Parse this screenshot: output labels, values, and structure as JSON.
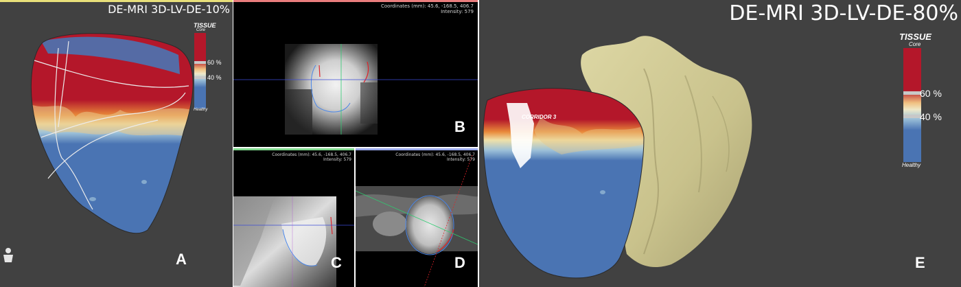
{
  "panel_a": {
    "title": "DE-MRI 3D-LV-DE-10%",
    "label": "A",
    "legend": {
      "title": "TISSUE",
      "top": "Core",
      "bottom": "Healthy",
      "upper_threshold": "60 %",
      "lower_threshold": "40 %"
    }
  },
  "panel_b": {
    "label": "B",
    "coords": "Coordinates (mm): 45.6, -168.5, 406.7",
    "intensity": "Intensity: 579"
  },
  "panel_c": {
    "label": "C",
    "coords": "Coordinates (mm): 45.6, -168.5, 406.7",
    "intensity": "Intensity: 579"
  },
  "panel_d": {
    "label": "D",
    "coords": "Coordinates (mm): 45.6, -168.5, 406.7",
    "intensity": "Intensity: 579"
  },
  "panel_e": {
    "title": "DE-MRI 3D-LV-DE-80%",
    "label": "E",
    "annotation": "CORRIDOR 3",
    "legend": {
      "title": "TISSUE",
      "top": "Core",
      "bottom": "Healthy",
      "upper_threshold": "60 %",
      "lower_threshold": "40 %"
    }
  },
  "colors": {
    "panel_bg": "#414141",
    "core": "#b4172a",
    "healthy": "#4a74b3",
    "atrium": "#cfc893",
    "crosshair_green": "#2ecc71",
    "crosshair_blue": "#3b4bd6",
    "contour_red": "#e0232a",
    "contour_blue": "#4a86e8"
  },
  "icons": {
    "orientation": "person-orientation-icon"
  }
}
